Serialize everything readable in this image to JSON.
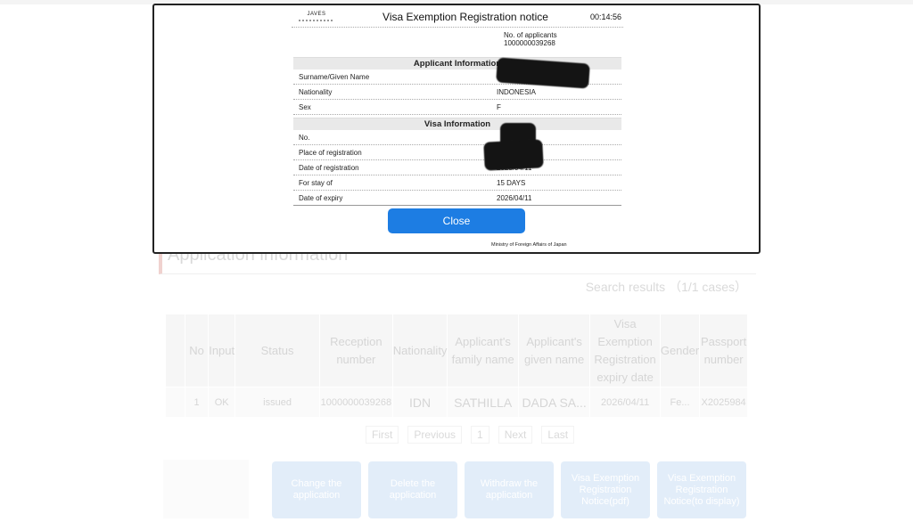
{
  "background": {
    "heading": "Application information",
    "search_results": "Search results （1/1 cases）",
    "table": {
      "headers": [
        "",
        "No",
        "Input",
        "Status",
        "Reception number",
        "Nationality",
        "Applicant's family name",
        "Applicant's given name",
        "Visa Exemption Registration expiry date",
        "Gender",
        "Passport number"
      ],
      "row": [
        "",
        "1",
        "OK",
        "issued",
        "1000000039268",
        "IDN",
        "SATHILLA",
        "DADA SA...",
        "2026/04/11",
        "Fe...",
        "X2025984"
      ]
    },
    "pager": [
      "First",
      "Previous",
      "1",
      "Next",
      "Last"
    ],
    "buttons": [
      "Change the application",
      "Delete the application",
      "Withdraw the application",
      "Visa Exemption Registration Notice(pdf)",
      "Visa Exemption Registration Notice(to display)"
    ]
  },
  "modal": {
    "logo_text": "JAVES",
    "title": "Visa Exemption Registration notice",
    "timer": "00:14:56",
    "applicants_label": "No. of applicants",
    "applicants_value": "1000000039268",
    "applicant_section": "Applicant Information",
    "applicant_rows": [
      {
        "label": "Surname/Given Name",
        "value": ""
      },
      {
        "label": "Nationality",
        "value": "INDONESIA"
      },
      {
        "label": "Sex",
        "value": "F"
      }
    ],
    "visa_section": "Visa Information",
    "visa_rows": [
      {
        "label": "No.",
        "value": ""
      },
      {
        "label": "Place of registration",
        "value": ""
      },
      {
        "label": "Date of registration",
        "value": "2023/04/11"
      },
      {
        "label": "For stay of",
        "value": "15 DAYS"
      },
      {
        "label": "Date of expiry",
        "value": "2026/04/11"
      }
    ],
    "close_label": "Close",
    "footer": "Ministry of Foreign Affairs of Japan"
  }
}
